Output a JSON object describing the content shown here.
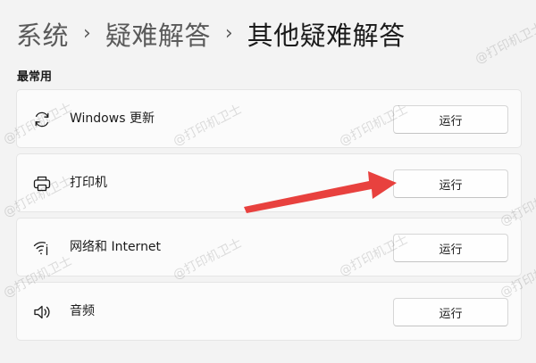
{
  "breadcrumb": {
    "items": [
      "系统",
      "疑难解答",
      "其他疑难解答"
    ],
    "separator": "›"
  },
  "section": {
    "title": "最常用"
  },
  "troubleshooters": [
    {
      "label": "Windows 更新",
      "icon": "refresh-icon",
      "button": "运行"
    },
    {
      "label": "打印机",
      "icon": "printer-icon",
      "button": "运行"
    },
    {
      "label": "网络和 Internet",
      "icon": "wifi-icon",
      "button": "运行"
    },
    {
      "label": "音频",
      "icon": "speaker-icon",
      "button": "运行"
    }
  ],
  "watermark": {
    "text": "@打印机卫士"
  },
  "annotation": {
    "arrow_color": "#e8413e"
  }
}
